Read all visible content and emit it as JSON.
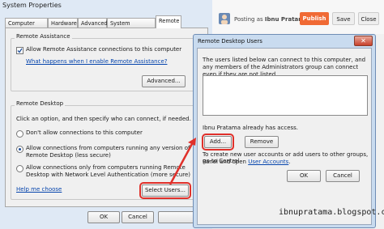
{
  "system_properties": {
    "title": "System Properties",
    "tabs": [
      "Computer Name",
      "Hardware",
      "Advanced",
      "System Protection",
      "Remote"
    ],
    "remote_assistance": {
      "group_title": "Remote Assistance",
      "checkbox_label": "Allow Remote Assistance connections to this computer",
      "link": "What happens when I enable Remote Assistance?",
      "advanced_button": "Advanced..."
    },
    "remote_desktop": {
      "group_title": "Remote Desktop",
      "instruction": "Click an option, and then specify who can connect, if needed.",
      "option1": "Don't allow connections to this computer",
      "option2_line1": "Allow connections from computers running any version of",
      "option2_line2": "Remote Desktop (less secure)",
      "option3_line1": "Allow connections only from computers running Remote",
      "option3_line2": "Desktop with Network Level Authentication (more secure)",
      "help_link": "Help me choose",
      "select_users_button": "Select Users..."
    },
    "ok_button": "OK",
    "cancel_button": "Cancel"
  },
  "blogger_bar": {
    "posting_as": "Posting as",
    "user": "Ibnu Pratama",
    "publish_button": "Publish",
    "save_button": "Save",
    "close_button": "Close"
  },
  "rdu_dialog": {
    "title": "Remote Desktop Users",
    "description": "The users listed below can connect to this computer, and any members of the Administrators group can connect even if they are not listed.",
    "access_note": "Ibnu Pratama already has access.",
    "add_button": "Add...",
    "remove_button": "Remove",
    "footer_text_line1": "To create new user accounts or add users to other groups, go to Control",
    "footer_text_line2_prefix": "Panel and open ",
    "user_accounts_link": "User Accounts",
    "footer_text_line2_suffix": ".",
    "ok_button": "OK",
    "cancel_button": "Cancel"
  },
  "watermark": "ibnupratama.blogspot.com",
  "colors": {
    "publish": "#f06a35",
    "highlight_red": "#e0302a",
    "link": "#0645ad"
  }
}
